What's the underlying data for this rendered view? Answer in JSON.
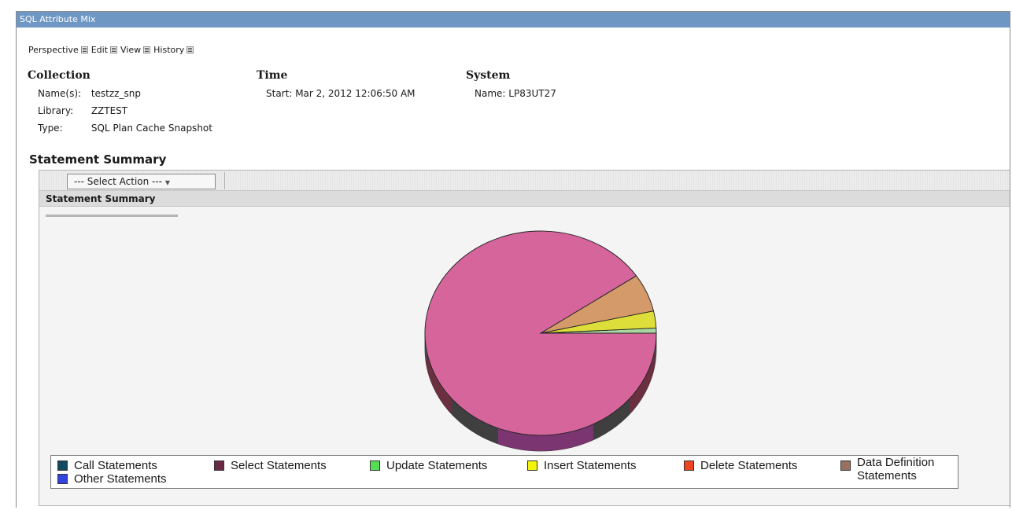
{
  "window": {
    "title": "SQL Attribute Mix"
  },
  "menu": [
    "Perspective",
    "Edit",
    "View",
    "History"
  ],
  "collection": {
    "heading": "Collection",
    "rows": [
      {
        "label": "Name(s):",
        "value": "testzz_snp"
      },
      {
        "label": "Library:",
        "value": "ZZTEST"
      },
      {
        "label": "Type:",
        "value": "SQL Plan Cache Snapshot"
      }
    ]
  },
  "time": {
    "heading": "Time",
    "start_label": "Start:",
    "start_value": "Mar 2, 2012 12:06:50 AM"
  },
  "system": {
    "heading": "System",
    "name_label": "Name:",
    "name_value": "LP83UT27"
  },
  "section_title": "Statement Summary",
  "panel": {
    "select_action": "--- Select Action ---",
    "header": "Statement Summary"
  },
  "chart_data": {
    "type": "pie",
    "title": "",
    "legend_position": "bottom",
    "slices": [
      {
        "name": "Call Statements",
        "value": 0,
        "color": "#1f4e6e"
      },
      {
        "name": "Select Statements",
        "value": 90.5,
        "color": "#d5659b"
      },
      {
        "name": "Update Statements",
        "value": 0.8,
        "color": "#a8d8a0"
      },
      {
        "name": "Insert Statements",
        "value": 2.7,
        "color": "#dede3a"
      },
      {
        "name": "Delete Statements",
        "value": 0,
        "color": "#e8452c"
      },
      {
        "name": "Data Definition Statements",
        "value": 6.0,
        "color": "#d49a6a"
      },
      {
        "name": "Other Statements",
        "value": 0,
        "color": "#3344cc"
      }
    ]
  },
  "legend": [
    {
      "label": "Call Statements",
      "color": "#0f4a60"
    },
    {
      "label": "Select Statements",
      "color": "#6a2a45"
    },
    {
      "label": "Update Statements",
      "color": "#55dd55"
    },
    {
      "label": "Insert Statements",
      "color": "#f4f40a"
    },
    {
      "label": "Delete Statements",
      "color": "#ee4422"
    },
    {
      "label": "Data Definition Statements",
      "color": "#9b7060"
    },
    {
      "label": "Other Statements",
      "color": "#3344dd"
    }
  ]
}
